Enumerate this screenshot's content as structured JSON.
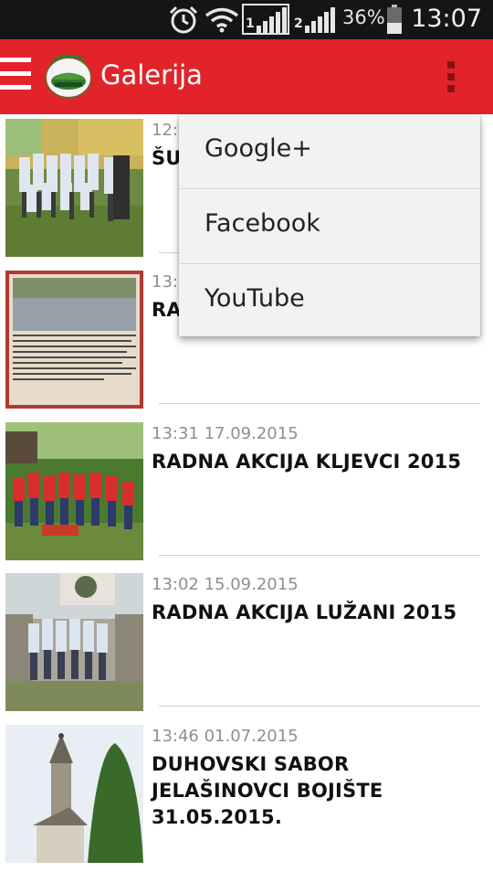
{
  "status_bar": {
    "battery_percent": "36%",
    "time": "13:07",
    "sim1": "1",
    "sim2": "2",
    "icons": [
      "alarm-icon",
      "wifi-icon",
      "signal-icon",
      "battery-icon"
    ]
  },
  "app_bar": {
    "title": "Galerija",
    "color": "#e2242a"
  },
  "menu": {
    "items": [
      {
        "label": "Google+"
      },
      {
        "label": "Facebook"
      },
      {
        "label": "YouTube"
      }
    ]
  },
  "gallery": {
    "items": [
      {
        "date": "12:0",
        "title": "ŠU"
      },
      {
        "date": "13:",
        "title": "RA"
      },
      {
        "date": "13:31 17.09.2015",
        "title": "RADNA AKCIJA KLJEVCI 2015"
      },
      {
        "date": "13:02 15.09.2015",
        "title": "RADNA AKCIJA LUŽANI 2015"
      },
      {
        "date": "13:46 01.07.2015",
        "title": "DUHOVSKI SABOR JELAŠINOVCI BOJIŠTE 31.05.2015."
      }
    ]
  }
}
